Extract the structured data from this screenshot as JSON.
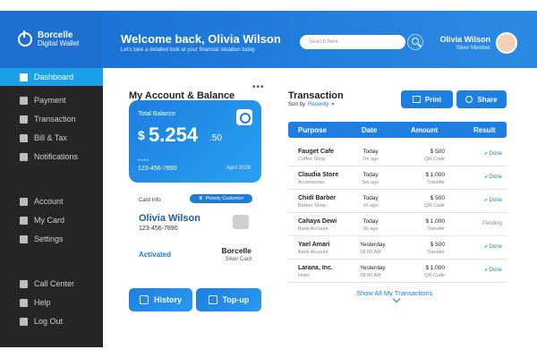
{
  "brand": {
    "line1": "Borcelle",
    "line2": "Digital Wallet"
  },
  "sidebar": {
    "items": [
      {
        "label": "Dashboard",
        "icon": "grid-icon",
        "active": true
      },
      {
        "label": "Payment",
        "icon": "payment-icon"
      },
      {
        "label": "Transaction",
        "icon": "transaction-icon"
      },
      {
        "label": "Bill & Tax",
        "icon": "bill-icon"
      },
      {
        "label": "Notifications",
        "icon": "bell-icon"
      },
      {
        "label": "Account",
        "icon": "user-icon"
      },
      {
        "label": "My Card",
        "icon": "card-icon"
      },
      {
        "label": "Settings",
        "icon": "gear-icon"
      },
      {
        "label": "Call Center",
        "icon": "headset-icon"
      },
      {
        "label": "Help",
        "icon": "help-icon"
      },
      {
        "label": "Log Out",
        "icon": "logout-icon"
      }
    ]
  },
  "header": {
    "welcome": "Welcome back, Olivia Wilson",
    "subtitle": "Let's take a detailed look at your financial situation today",
    "search_placeholder": "Search here",
    "user_name": "Olivia Wilson",
    "user_role": "Silver Member"
  },
  "account": {
    "title": "My Account & Balance",
    "menu": "•••",
    "card": {
      "label": "Total Balance",
      "currency": "$",
      "amount": "5.254",
      "decimals": ".50",
      "masked": "****",
      "number": "123-456-7890",
      "expiry": "April 2028"
    },
    "card_info_label": "Card Info",
    "badge": "Priority Customer",
    "holder": "Olivia Wilson",
    "holder_number": "123-456-7890",
    "status": "Activated",
    "bank": "Borcelle",
    "card_type": "Silver Card",
    "history_label": "History",
    "topup_label": "Top-up"
  },
  "transactions": {
    "title": "Transaction",
    "sort_label": "Sort by",
    "sort_value": "Recently",
    "print_label": "Print",
    "share_label": "Share",
    "columns": [
      "Purpose",
      "Date",
      "Amount",
      "Result"
    ],
    "rows": [
      {
        "name": "Fauget Cafe",
        "sub": "Coffee Shop",
        "date": "Today",
        "time": "2m ago",
        "amount": "$ 500",
        "method": "QR Code",
        "result": "Done",
        "status": "done"
      },
      {
        "name": "Claudia Store",
        "sub": "Accessories",
        "date": "Today",
        "time": "5m ago",
        "amount": "$ 1.000",
        "method": "Transfer",
        "result": "Done",
        "status": "done"
      },
      {
        "name": "Chidi Barber",
        "sub": "Barber Shop",
        "date": "Today",
        "time": "1h ago",
        "amount": "$ 500",
        "method": "QR Code",
        "result": "Done",
        "status": "done"
      },
      {
        "name": "Cahaya Dewi",
        "sub": "Bank Account",
        "date": "Today",
        "time": "3h ago",
        "amount": "$ 1.000",
        "method": "Transfer",
        "result": "Pending",
        "status": "pending"
      },
      {
        "name": "Yael Amari",
        "sub": "Bank Account",
        "date": "Yesterday",
        "time": "09:00 AM",
        "amount": "$ 500",
        "method": "Transfer",
        "result": "Done",
        "status": "done"
      },
      {
        "name": "Larana, Inc.",
        "sub": "Hotel",
        "date": "Yesterday",
        "time": "08:00 AM",
        "amount": "$ 1.000",
        "method": "QR Code",
        "result": "Done",
        "status": "done"
      }
    ],
    "show_all": "Show All My Transactions"
  }
}
